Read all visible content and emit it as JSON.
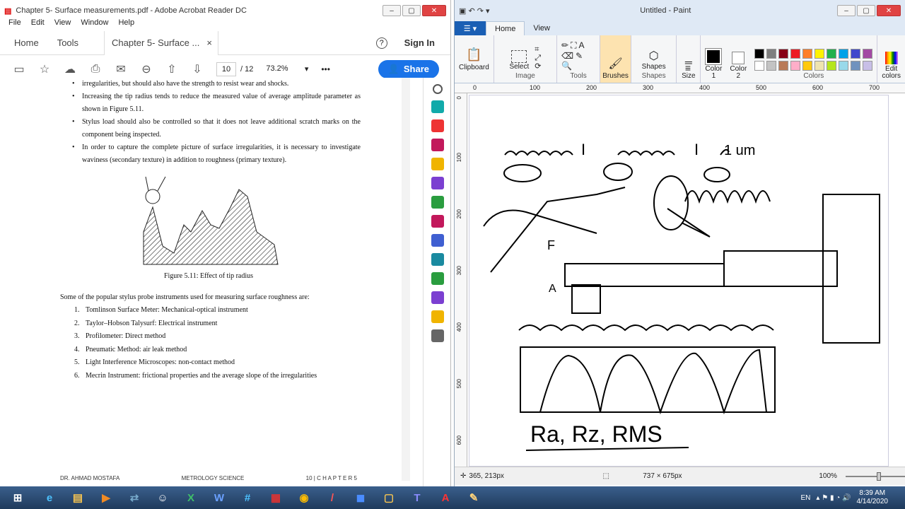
{
  "acrobat": {
    "title": "Chapter 5- Surface measurements.pdf - Adobe Acrobat Reader DC",
    "menu": [
      "File",
      "Edit",
      "View",
      "Window",
      "Help"
    ],
    "tabs": {
      "home": "Home",
      "tools": "Tools",
      "doc": "Chapter 5- Surface ...",
      "close": "×"
    },
    "help": "?",
    "signin": "Sign In",
    "page_current": "10",
    "page_total": "/ 12",
    "zoom": "73.2%",
    "more": "•••",
    "share": "Share",
    "content": {
      "bullets": [
        "irregularities, but should also have the strength to resist wear and shocks.",
        "Increasing the tip radius tends to reduce the measured value of average amplitude parameter as shown in Figure 5.11.",
        "Stylus load should also be controlled so that it does not leave additional scratch marks on the component being inspected.",
        "In order to capture the complete picture of surface irregularities, it is necessary to investigate waviness (secondary texture) in addition to roughness (primary texture)."
      ],
      "figure_caption": "Figure 5.11: Effect of tip radius",
      "intro": "Some of the popular stylus probe instruments used for measuring surface roughness are:",
      "list": [
        {
          "n": "1.",
          "t": "Tomlinson Surface Meter: Mechanical-optical instrument"
        },
        {
          "n": "2.",
          "t": "Taylor–Hobson Talysurf: Electrical instrument"
        },
        {
          "n": "3.",
          "t": "Profilometer: Direct method"
        },
        {
          "n": "4.",
          "t": "Pneumatic Method: air leak method"
        },
        {
          "n": "5.",
          "t": "Light Interference Microscopes: non-contact method"
        },
        {
          "n": "6.",
          "t": "Mecrin Instrument: frictional properties and the average slope of the irregularities"
        }
      ],
      "footer_left": "DR. AHMAD MOSTAFA",
      "footer_mid": "METROLOGY SCIENCE",
      "footer_right": "10 | C H A P T E R 5"
    }
  },
  "paint": {
    "title": "Untitled - Paint",
    "file_tab": "☰ ▾",
    "tabs": [
      "Home",
      "View"
    ],
    "groups": {
      "clipboard": "Clipboard",
      "select": "Select",
      "image": "Image",
      "tools": "Tools",
      "brushes": "Brushes",
      "shapes_btn": "Shapes",
      "shapes": "Shapes",
      "size": "Size",
      "color1": "Color 1",
      "color2": "Color 2",
      "colors": "Colors",
      "edit_colors": "Edit colors"
    },
    "palette": [
      "#000000",
      "#7f7f7f",
      "#880015",
      "#ed1c24",
      "#ff7f27",
      "#fff200",
      "#22b14c",
      "#00a2e8",
      "#3f48cc",
      "#a349a4",
      "#ffffff",
      "#c3c3c3",
      "#b97a57",
      "#ffaec9",
      "#ffc90e",
      "#efe4b0",
      "#b5e61d",
      "#99d9ea",
      "#7092be",
      "#c8bfe7"
    ],
    "ruler_h": [
      "0",
      "100",
      "200",
      "300",
      "400",
      "500",
      "600",
      "700"
    ],
    "ruler_v": [
      "0",
      "100",
      "200",
      "300",
      "400",
      "500",
      "600"
    ],
    "canvas_text": "Ra, Rz, RMS",
    "canvas_labels": [
      "F",
      "A",
      "I",
      "1 um"
    ],
    "status": {
      "pos": "365, 213px",
      "size": "737 × 675px",
      "zoom": "100%"
    }
  },
  "taskbar": {
    "apps": [
      "⊞",
      "e",
      "▤",
      "▶",
      "⇄",
      "☺",
      "X",
      "W",
      "#",
      "▦",
      "◉",
      "/",
      "◼",
      "▢",
      "T",
      "A",
      "✎"
    ],
    "lang": "EN",
    "time": "8:39 AM",
    "date": "4/14/2020"
  }
}
